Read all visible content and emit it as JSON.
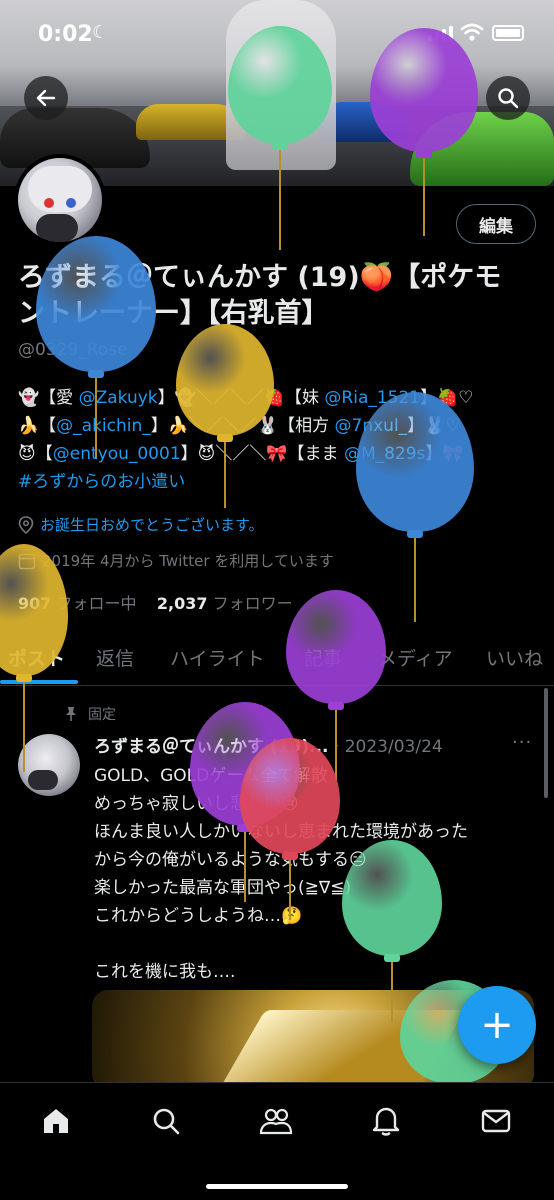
{
  "status_bar": {
    "time": "0:02"
  },
  "profile": {
    "edit_label": "編集",
    "name_line1": "ろずまる＠てぃんかす (19)🍑【ポケモ",
    "name_line2": "ントレーナー】【右乳首】",
    "handle": "@0329_Rose",
    "bio": {
      "line1_a": "👻【愛 ",
      "line1_link1": "@Zakuyk",
      "line1_b": "】👻＼／＼／🍓【妹 ",
      "line1_link2": "@Ria_1521",
      "line1_c": "】🍓♡",
      "line2_a": "🍌【",
      "line2_link1": "@_akichin_",
      "line2_b": "】🍌＼／＼／🐰【相方 ",
      "line2_link2": "@7nxul_",
      "line2_c": "】🐰♡",
      "line3_a": "😈【",
      "line3_link1": "@entyou_0001",
      "line3_b": "】😈＼／＼🎀【まま ",
      "line3_link2": "@M_829s",
      "line3_c": "】🎀",
      "hashtag": "#ろずからのお小遣い"
    },
    "birthday_text": "お誕生日おめでとうございます。",
    "joined_text": "2019年 4月から Twitter を利用しています",
    "following_count": "907",
    "following_label": "フォロー中",
    "followers_count": "2,037",
    "followers_label": "フォロワー"
  },
  "tabs": [
    "ポスト",
    "返信",
    "ハイライト",
    "記事",
    "メディア",
    "いいね"
  ],
  "post": {
    "pinned_label": "固定",
    "author": "ろずまる＠てぃんかす (19)...",
    "date": "· 2023/03/24",
    "more": "···",
    "lines": [
      "GOLD、GOLDゲーム全て解散",
      "めっちゃ寂しいし悲しい😢",
      "ほんま良い人しかいないし恵まれた環境があった",
      "から今の俺がいるような気もする😑",
      "楽しかった最高な軍団やっ(≧∇≦)",
      "これからどうしようね…🤔",
      "",
      "これを機に我も…."
    ]
  },
  "fab_label": "+",
  "nav": [
    "home-icon",
    "search-icon",
    "communities-icon",
    "notifications-icon",
    "messages-icon"
  ],
  "colors": {
    "accent": "#1d9bf0",
    "balloon_green": "#5ed39a",
    "balloon_purple": "#9b3fd6",
    "balloon_blue": "#3d86d8",
    "balloon_yellow": "#e0b62f",
    "balloon_red": "#e0485a"
  }
}
